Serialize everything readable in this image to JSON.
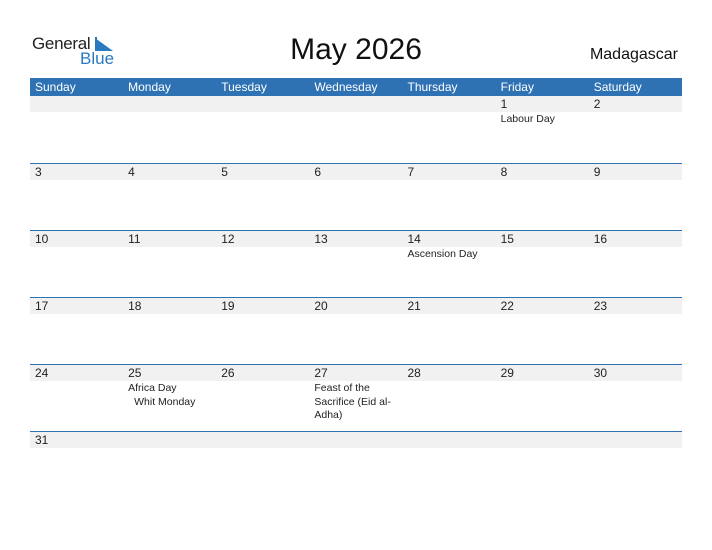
{
  "logo": {
    "line1": "General",
    "line2": "Blue"
  },
  "header": {
    "title": "May 2026",
    "country": "Madagascar"
  },
  "colors": {
    "accent": "#2e72b4",
    "band": "#f1f1f1",
    "logo_blue": "#2a7ac0"
  },
  "weekdays": [
    "Sunday",
    "Monday",
    "Tuesday",
    "Wednesday",
    "Thursday",
    "Friday",
    "Saturday"
  ],
  "weeks": [
    [
      {
        "day": ""
      },
      {
        "day": ""
      },
      {
        "day": ""
      },
      {
        "day": ""
      },
      {
        "day": ""
      },
      {
        "day": "1",
        "events": [
          "Labour Day"
        ]
      },
      {
        "day": "2"
      }
    ],
    [
      {
        "day": "3"
      },
      {
        "day": "4"
      },
      {
        "day": "5"
      },
      {
        "day": "6"
      },
      {
        "day": "7"
      },
      {
        "day": "8"
      },
      {
        "day": "9"
      }
    ],
    [
      {
        "day": "10"
      },
      {
        "day": "11"
      },
      {
        "day": "12"
      },
      {
        "day": "13"
      },
      {
        "day": "14",
        "events": [
          "Ascension Day"
        ]
      },
      {
        "day": "15"
      },
      {
        "day": "16"
      }
    ],
    [
      {
        "day": "17"
      },
      {
        "day": "18"
      },
      {
        "day": "19"
      },
      {
        "day": "20"
      },
      {
        "day": "21"
      },
      {
        "day": "22"
      },
      {
        "day": "23"
      }
    ],
    [
      {
        "day": "24"
      },
      {
        "day": "25",
        "events": [
          "Africa Day",
          "Whit Monday"
        ]
      },
      {
        "day": "26"
      },
      {
        "day": "27",
        "events": [
          "Feast of the Sacrifice (Eid al-Adha)"
        ]
      },
      {
        "day": "28"
      },
      {
        "day": "29"
      },
      {
        "day": "30"
      }
    ],
    [
      {
        "day": "31"
      },
      {
        "day": ""
      },
      {
        "day": ""
      },
      {
        "day": ""
      },
      {
        "day": ""
      },
      {
        "day": ""
      },
      {
        "day": ""
      }
    ]
  ]
}
